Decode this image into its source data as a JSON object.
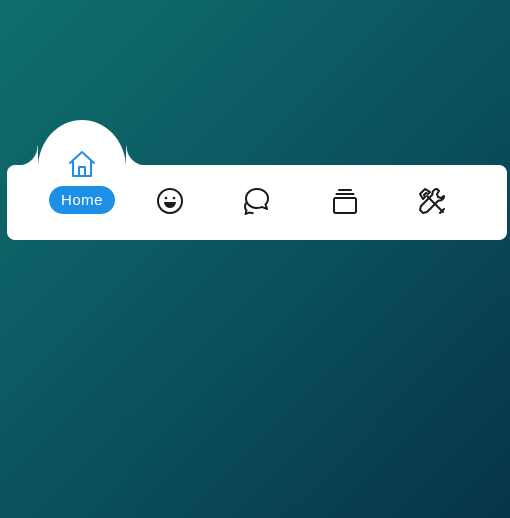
{
  "nav": {
    "items": [
      {
        "id": "home",
        "label": "Home",
        "icon": "home-icon",
        "active": true
      },
      {
        "id": "emoji",
        "label": "",
        "icon": "smiley-icon",
        "active": false
      },
      {
        "id": "chat",
        "label": "",
        "icon": "chat-bubbles-icon",
        "active": false
      },
      {
        "id": "stack",
        "label": "",
        "icon": "stacked-cards-icon",
        "active": false
      },
      {
        "id": "tools",
        "label": "",
        "icon": "tools-icon",
        "active": false
      }
    ]
  },
  "colors": {
    "accent": "#1e8fe6",
    "icon": "#1b1b1b",
    "background_start": "#0f6f6d",
    "background_end": "#073448",
    "bar": "#ffffff"
  }
}
